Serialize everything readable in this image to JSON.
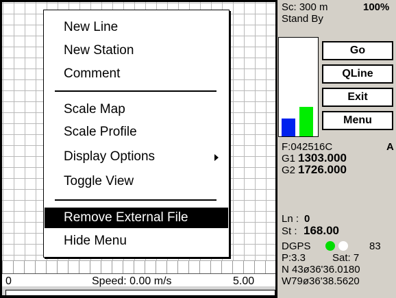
{
  "menu": {
    "items": [
      {
        "label": "New Line"
      },
      {
        "label": "New Station"
      },
      {
        "label": "Comment"
      },
      {
        "label": "Scale Map"
      },
      {
        "label": "Scale Profile"
      },
      {
        "label": "Display Options"
      },
      {
        "label": "Toggle View"
      },
      {
        "label": "Remove External File"
      },
      {
        "label": "Hide Menu"
      }
    ]
  },
  "map": {
    "scale_left": "0",
    "speed": "Speed: 0.00 m/s",
    "scale_right": "5.00"
  },
  "panel": {
    "scale": "Sc: 300 m",
    "zoom": "100%",
    "status": "Stand By",
    "buttons": {
      "go": "Go",
      "qline": "QLine",
      "exit": "Exit",
      "menu": "Menu"
    },
    "file": "F:042516C",
    "file_flag": "A",
    "g1_label": "G1",
    "g1_value": "1303.000",
    "g2_label": "G2",
    "g2_value": "1726.000",
    "ln_label": "Ln :",
    "ln_value": "0",
    "st_label": "St :",
    "st_value": "168.00",
    "dgps_label": "DGPS",
    "dgps_value": "83",
    "p_value": "P:3.3",
    "sat": "Sat: 7",
    "lat": "N 43ø36'36.0180",
    "lon": "W79ø36'38.5620",
    "bars": [
      {
        "color": "#0022ee",
        "level": 0.18
      },
      {
        "color": "#00ee00",
        "level": 0.3
      }
    ],
    "dgps_dots": [
      {
        "color": "#00dd00"
      },
      {
        "color": "#ffffff"
      }
    ]
  }
}
